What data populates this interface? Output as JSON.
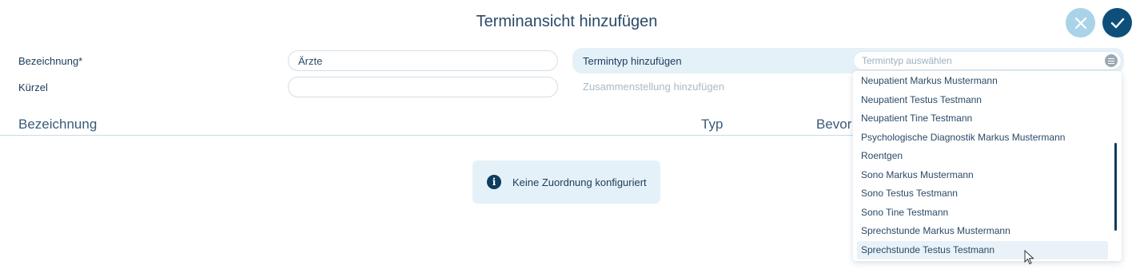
{
  "dialog": {
    "title": "Terminansicht hinzufügen"
  },
  "actions": {
    "cancel_icon": "close-icon",
    "confirm_icon": "check-icon",
    "cancel_color": "#a9d3e8",
    "confirm_color": "#0d4f7a"
  },
  "form": {
    "bezeichnung_label": "Bezeichnung*",
    "bezeichnung_value": "Ärzte",
    "kuerzel_label": "Kürzel",
    "kuerzel_value": ""
  },
  "termintyp": {
    "label": "Termintyp hinzufügen",
    "placeholder": "Termintyp auswählen",
    "zusammenstellung_label": "Zusammenstellung hinzufügen",
    "options": [
      "Neupatient Markus Mustermann",
      "Neupatient Testus Testmann",
      "Neupatient Tine Testmann",
      "Psychologische Diagnostik Markus Mustermann",
      "Roentgen",
      "Sono Markus Mustermann",
      "Sono Testus Testmann",
      "Sono Tine Testmann",
      "Sprechstunde Markus Mustermann",
      "Sprechstunde Testus Testmann"
    ],
    "hovered_option": "Sprechstunde Testus Testmann"
  },
  "table": {
    "columns": [
      "Bezeichnung",
      "Typ",
      "Bevor"
    ]
  },
  "info": {
    "message": "Keine Zuordnung konfiguriert",
    "icon": "info-icon"
  }
}
